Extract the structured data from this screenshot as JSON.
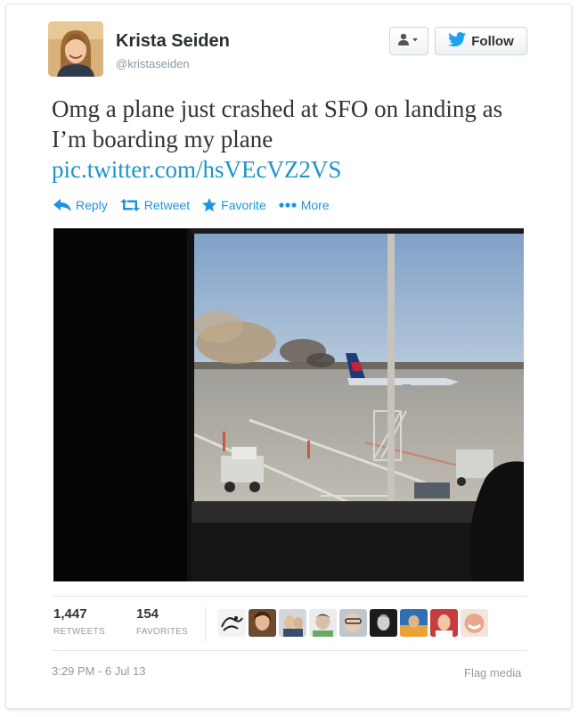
{
  "user": {
    "display_name": "Krista Seiden",
    "screen_name": "@kristaseiden",
    "avatar_icon": "user-avatar"
  },
  "header": {
    "follow_label": "Follow",
    "user_menu_icon": "person-dropdown-icon"
  },
  "tweet": {
    "text": "Omg a plane just crashed at SFO on landing as I’m boarding my plane",
    "link": "pic.twitter.com/hsVEcVZ2VS"
  },
  "actions": {
    "reply": "Reply",
    "retweet": "Retweet",
    "favorite": "Favorite",
    "more": "More"
  },
  "stats": {
    "retweets_count": "1,447",
    "retweets_label": "RETWEETS",
    "favorites_count": "154",
    "favorites_label": "FAVORITES"
  },
  "footer": {
    "timestamp": "3:29 PM - 6 Jul 13",
    "flag_label": "Flag media"
  },
  "colors": {
    "link": "#1b95e0",
    "text": "#333333",
    "muted": "#999999"
  }
}
